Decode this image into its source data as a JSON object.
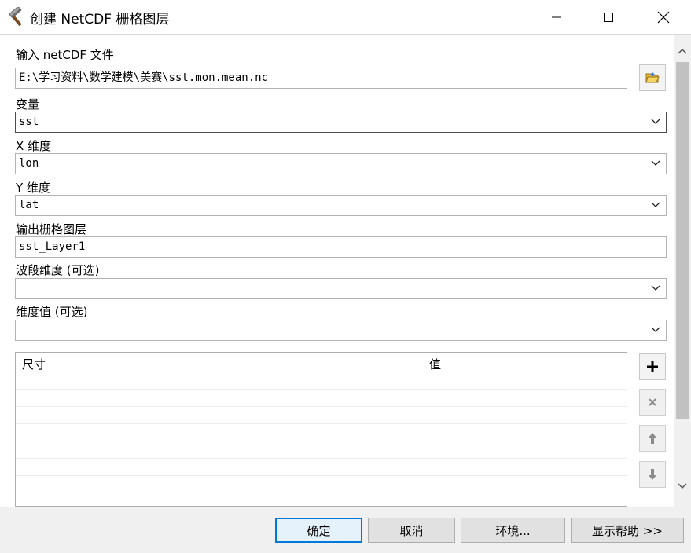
{
  "window": {
    "title": "创建 NetCDF 栅格图层",
    "icon": "hammer-icon"
  },
  "fields": {
    "input_file": {
      "label": "输入 netCDF 文件",
      "value": "E:\\学习资料\\数学建模\\美赛\\sst.mon.mean.nc"
    },
    "variable": {
      "label": "变量",
      "value": "sst"
    },
    "x_dim": {
      "label": "X 维度",
      "value": "lon"
    },
    "y_dim": {
      "label": "Y 维度",
      "value": "lat"
    },
    "output_layer": {
      "label": "输出栅格图层",
      "value": "sst_Layer1"
    },
    "band_dim": {
      "label": "波段维度 (可选)",
      "value": ""
    },
    "dim_values": {
      "label": "维度值 (可选)",
      "value": ""
    }
  },
  "table": {
    "columns": [
      "尺寸",
      "值"
    ],
    "rows": []
  },
  "footer": {
    "ok": "确定",
    "cancel": "取消",
    "env": "环境...",
    "help": "显示帮助 >>"
  },
  "colors": {
    "default_border": "#0078d7",
    "button_bg": "#e1e1e1",
    "footer_bg": "#f0f0f0"
  }
}
